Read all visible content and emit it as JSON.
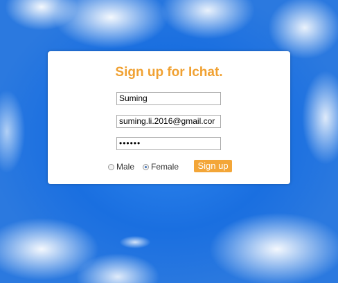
{
  "form": {
    "title": "Sign up for Ichat.",
    "name_value": "Suming",
    "email_value": "suming.li.2016@gmail.cor",
    "password_value": "••••••",
    "gender": {
      "male_label": "Male",
      "female_label": "Female",
      "selected": "Female"
    },
    "signup_label": "Sign up"
  },
  "colors": {
    "accent": "#f0a132",
    "button": "#f3a638",
    "sky": "#1a6fe0"
  }
}
